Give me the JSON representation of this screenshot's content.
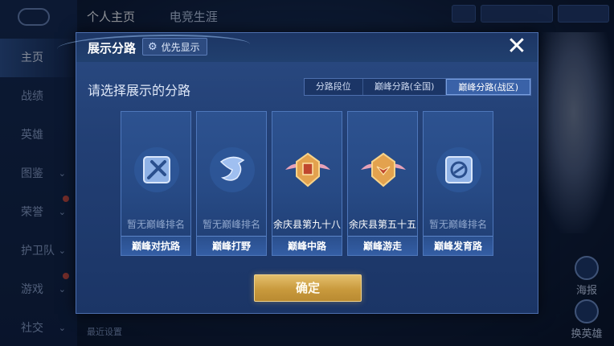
{
  "background": {
    "nav_items": [
      {
        "label": "主页",
        "active": true,
        "chevron": false
      },
      {
        "label": "战绩",
        "active": false,
        "chevron": false
      },
      {
        "label": "英雄",
        "active": false,
        "chevron": false
      },
      {
        "label": "图鉴",
        "active": false,
        "chevron": true
      },
      {
        "label": "荣誉",
        "active": false,
        "chevron": true
      },
      {
        "label": "护卫队",
        "active": false,
        "chevron": true
      },
      {
        "label": "游戏",
        "active": false,
        "chevron": true
      },
      {
        "label": "社交",
        "active": false,
        "chevron": true
      }
    ],
    "top_tabs": [
      "个人主页",
      "电竞生涯"
    ],
    "side_buttons": [
      "海报",
      "换英雄"
    ],
    "bottom_text": "最近设置"
  },
  "modal": {
    "title": "展示分路",
    "priority_label": "优先显示",
    "close_glyph": "✕",
    "prompt": "请选择展示的分路",
    "segment_tabs": [
      {
        "label": "分路段位",
        "active": false
      },
      {
        "label": "巅峰分路(全国)",
        "active": false
      },
      {
        "label": "巅峰分路(战区)",
        "active": true
      }
    ],
    "cards": [
      {
        "role": "巅峰对抗路",
        "rank": "暂无巅峰排名",
        "has_rank": false,
        "icon": "sword-shield-icon"
      },
      {
        "role": "巅峰打野",
        "rank": "暂无巅峰排名",
        "has_rank": false,
        "icon": "dragon-icon"
      },
      {
        "role": "巅峰中路",
        "rank": "余庆县第九十八",
        "has_rank": true,
        "icon": "gold-winged-emblem-icon"
      },
      {
        "role": "巅峰游走",
        "rank": "余庆县第五十五",
        "has_rank": true,
        "icon": "gold-winged-emblem-icon"
      },
      {
        "role": "巅峰发育路",
        "rank": "暂无巅峰排名",
        "has_rank": false,
        "icon": "archer-target-icon"
      }
    ],
    "confirm_label": "确定"
  },
  "colors": {
    "panel": "#223f74",
    "card": "#2d5290",
    "accent_gold": "#c99a3d",
    "active_tab": "#3a62a8"
  }
}
